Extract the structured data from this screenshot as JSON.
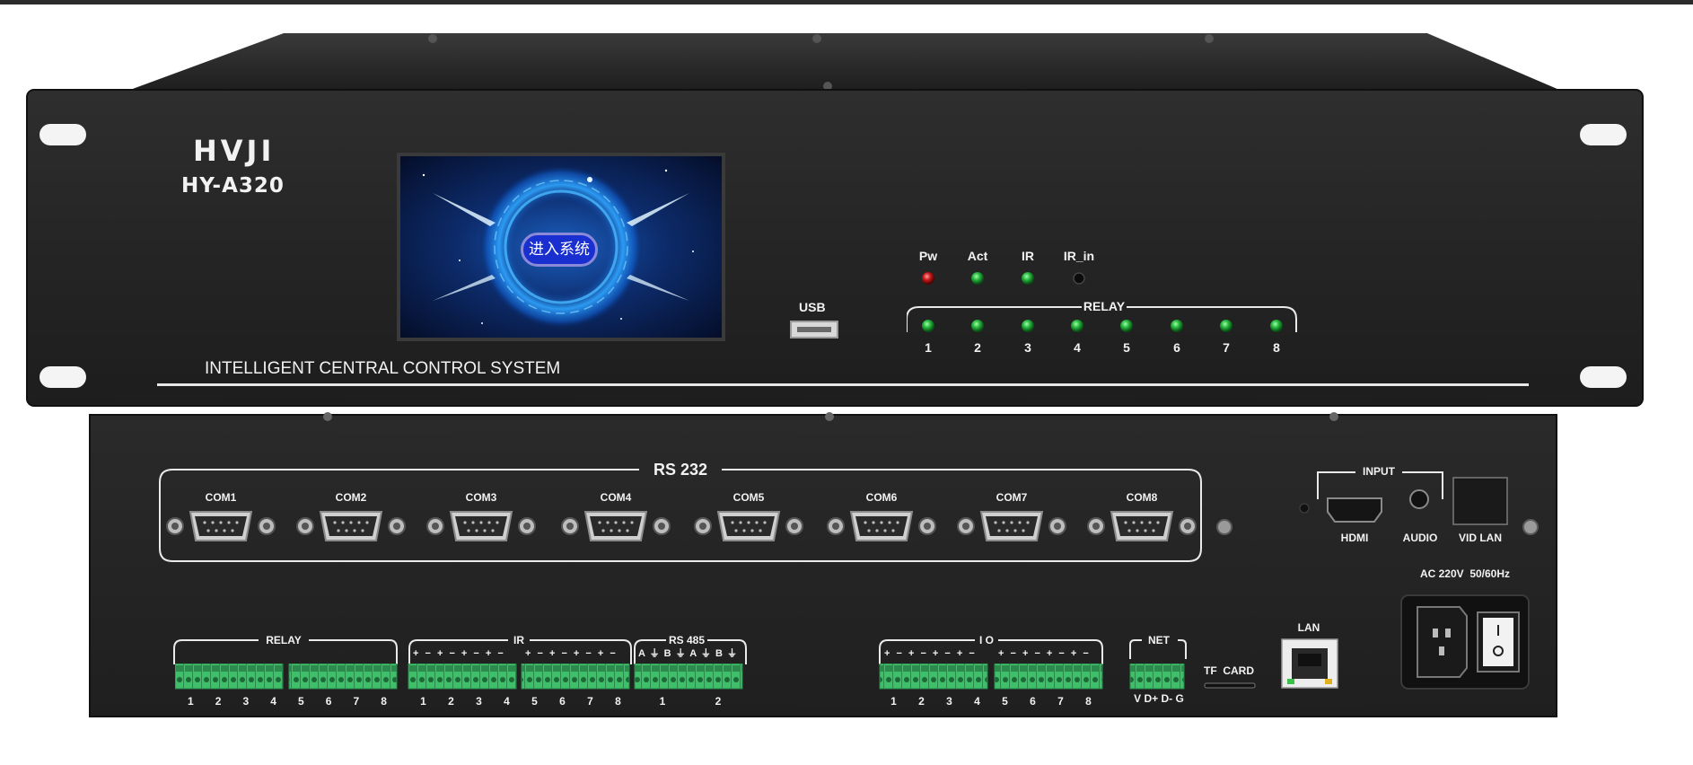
{
  "colors": {
    "chassis": "#262626",
    "screen_glow": "#2fa6ff",
    "led_green": "#23b13a",
    "led_red": "#c41616",
    "terminal_green": "#3fbf6a",
    "label": "#f2f2f2"
  },
  "front": {
    "brand_logo": "HVJI",
    "model": "HY-A320",
    "tagline": "INTELLIGENT CENTRAL CONTROL SYSTEM",
    "screen": {
      "button_label": "进入系统"
    },
    "usb_label": "USB",
    "indicators": [
      {
        "label": "Pw",
        "color": "red"
      },
      {
        "label": "Act",
        "color": "green"
      },
      {
        "label": "IR",
        "color": "green"
      },
      {
        "label": "IR_in",
        "color": "sensor"
      }
    ],
    "relay_label": "RELAY",
    "relay_numbers": [
      "1",
      "2",
      "3",
      "4",
      "5",
      "6",
      "7",
      "8"
    ]
  },
  "rear": {
    "rs232_label": "RS 232",
    "com_ports": [
      "COM1",
      "COM2",
      "COM3",
      "COM4",
      "COM5",
      "COM6",
      "COM7",
      "COM8"
    ],
    "input_label": "INPUT",
    "hdmi_label": "HDMI",
    "audio_label": "AUDIO",
    "vid_lan_label": "VID LAN",
    "power_label": "AC 220V  50/60Hz",
    "relay_label": "RELAY",
    "relay_numbers": [
      "1",
      "2",
      "3",
      "4",
      "5",
      "6",
      "7",
      "8"
    ],
    "ir_label": "IR",
    "ir_signs": "+ − + − + − + −",
    "ir_numbers": [
      "1",
      "2",
      "3",
      "4",
      "5",
      "6",
      "7",
      "8"
    ],
    "rs485_label": "RS 485",
    "rs485_signs": "A ⏚ B ⏚ A ⏚ B ⏚",
    "rs485_numbers": [
      "1",
      "2"
    ],
    "io_label": "I O",
    "io_signs": "+ − + − + − + −",
    "io_numbers": [
      "1",
      "2",
      "3",
      "4",
      "5",
      "6",
      "7",
      "8"
    ],
    "net_label": "NET",
    "net_pins": "V D+ D- G",
    "tf_card_label": "TF  CARD",
    "lan_label": "LAN"
  }
}
